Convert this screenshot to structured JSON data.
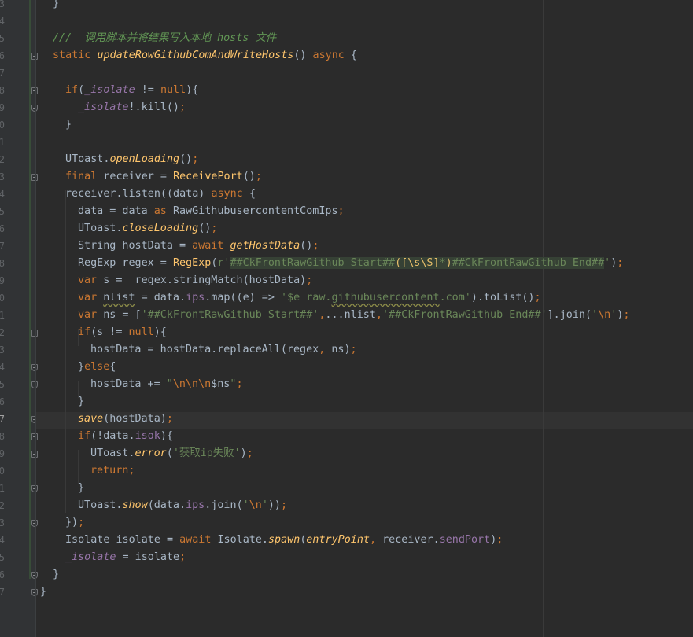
{
  "editor": {
    "colors": {
      "background": "#2b2b2b",
      "gutter": "#313335",
      "caret_line": "#323232",
      "keyword": "#cc7832",
      "function": "#ffc66d",
      "field": "#9876aa",
      "string": "#6a8759",
      "comment": "#629755",
      "text": "#a9b7c6",
      "line_number": "#606366"
    },
    "current_line_number": "7",
    "lines": [
      {
        "n": "3",
        "indent": 1,
        "tokens": [
          [
            "}",
            "p"
          ]
        ]
      },
      {
        "n": "4",
        "indent": 0,
        "tokens": []
      },
      {
        "n": "5",
        "indent": 1,
        "tokens": [
          [
            "///  调用脚本并将结果写入本地 hosts 文件",
            "com"
          ]
        ]
      },
      {
        "n": "6",
        "indent": 1,
        "tokens": [
          [
            "static ",
            "kw"
          ],
          [
            "updateRowGithubComAndWriteHosts",
            "fni"
          ],
          [
            "() ",
            "p"
          ],
          [
            "async ",
            "kw"
          ],
          [
            "{",
            "p"
          ]
        ]
      },
      {
        "n": "7",
        "indent": 0,
        "tokens": []
      },
      {
        "n": "8",
        "indent": 2,
        "tokens": [
          [
            "if",
            "kw"
          ],
          [
            "(",
            "p"
          ],
          [
            "_isolate",
            "fld"
          ],
          [
            " != ",
            "p"
          ],
          [
            "null",
            "kw"
          ],
          [
            "){",
            "p"
          ]
        ]
      },
      {
        "n": "9",
        "indent": 3,
        "tokens": [
          [
            "_isolate",
            "fld"
          ],
          [
            "!.kill()",
            "p"
          ],
          [
            ";",
            "kw"
          ]
        ]
      },
      {
        "n": "0",
        "indent": 2,
        "tokens": [
          [
            "}",
            "p"
          ]
        ]
      },
      {
        "n": "1",
        "indent": 0,
        "tokens": []
      },
      {
        "n": "2",
        "indent": 2,
        "tokens": [
          [
            "UToast.",
            "p"
          ],
          [
            "openLoading",
            "fni"
          ],
          [
            "()",
            "p"
          ],
          [
            ";",
            "kw"
          ]
        ]
      },
      {
        "n": "3",
        "indent": 2,
        "tokens": [
          [
            "final ",
            "kw"
          ],
          [
            "receiver = ",
            "p"
          ],
          [
            "ReceivePort",
            "fn"
          ],
          [
            "()",
            "p"
          ],
          [
            ";",
            "kw"
          ]
        ]
      },
      {
        "n": "4",
        "indent": 2,
        "tokens": [
          [
            "receiver.listen((data) ",
            "p"
          ],
          [
            "async ",
            "kw"
          ],
          [
            "{",
            "p"
          ]
        ]
      },
      {
        "n": "5",
        "indent": 3,
        "tokens": [
          [
            "data = data ",
            "p"
          ],
          [
            "as ",
            "kw"
          ],
          [
            "RawGithubusercontentComIps",
            "p"
          ],
          [
            ";",
            "kw"
          ]
        ]
      },
      {
        "n": "6",
        "indent": 3,
        "tokens": [
          [
            "UToast.",
            "p"
          ],
          [
            "closeLoading",
            "fni"
          ],
          [
            "()",
            "p"
          ],
          [
            ";",
            "kw"
          ]
        ]
      },
      {
        "n": "7",
        "indent": 3,
        "tokens": [
          [
            "String hostData = ",
            "p"
          ],
          [
            "await ",
            "kw"
          ],
          [
            "getHostData",
            "fni"
          ],
          [
            "()",
            "p"
          ],
          [
            ";",
            "kw"
          ]
        ]
      },
      {
        "n": "8",
        "indent": 3,
        "tokens": [
          [
            "RegExp regex = ",
            "p"
          ],
          [
            "RegExp",
            "fn"
          ],
          [
            "(",
            "p"
          ],
          [
            "r'",
            "str"
          ],
          [
            "##CkFrontRawGithub Start##",
            "regex"
          ],
          [
            "([\\s\\S]",
            "rxs"
          ],
          [
            "*",
            "regex"
          ],
          [
            ")",
            "rxs"
          ],
          [
            "##CkFrontRawGithub End##",
            "regex"
          ],
          [
            "'",
            "str"
          ],
          [
            ")",
            "p"
          ],
          [
            ";",
            "kw"
          ]
        ]
      },
      {
        "n": "9",
        "indent": 3,
        "tokens": [
          [
            "var ",
            "kw"
          ],
          [
            "s =  regex.stringMatch(hostData)",
            "p"
          ],
          [
            ";",
            "kw"
          ]
        ]
      },
      {
        "n": "0",
        "indent": 3,
        "tokens": [
          [
            "var ",
            "kw"
          ],
          [
            "nlist",
            "warn"
          ],
          [
            " = data.",
            "p"
          ],
          [
            "ips",
            "prop"
          ],
          [
            ".map((e) => ",
            "p"
          ],
          [
            "'$e ",
            "str"
          ],
          [
            "raw.",
            "str"
          ],
          [
            "githubusercontent",
            "strwarn"
          ],
          [
            ".com'",
            "str"
          ],
          [
            ").toList()",
            "p"
          ],
          [
            ";",
            "kw"
          ]
        ]
      },
      {
        "n": "1",
        "indent": 3,
        "tokens": [
          [
            "var ",
            "kw"
          ],
          [
            "ns = [",
            "p"
          ],
          [
            "'##CkFrontRawGithub Start##'",
            "str"
          ],
          [
            ",",
            "kw"
          ],
          [
            "...nlist",
            "p"
          ],
          [
            ",",
            "kw"
          ],
          [
            "'##CkFrontRawGithub End##'",
            "str"
          ],
          [
            "].join(",
            "p"
          ],
          [
            "'",
            "str"
          ],
          [
            "\\n",
            "esc"
          ],
          [
            "'",
            "str"
          ],
          [
            ")",
            "p"
          ],
          [
            ";",
            "kw"
          ]
        ]
      },
      {
        "n": "2",
        "indent": 3,
        "tokens": [
          [
            "if",
            "kw"
          ],
          [
            "(s != ",
            "p"
          ],
          [
            "null",
            "kw"
          ],
          [
            "){",
            "p"
          ]
        ]
      },
      {
        "n": "3",
        "indent": 4,
        "tokens": [
          [
            "hostData = hostData.replaceAll(regex",
            "p"
          ],
          [
            ", ",
            "kw"
          ],
          [
            "ns)",
            "p"
          ],
          [
            ";",
            "kw"
          ]
        ]
      },
      {
        "n": "4",
        "indent": 3,
        "tokens": [
          [
            "}",
            "p"
          ],
          [
            "else",
            "kw"
          ],
          [
            "{",
            "p"
          ]
        ]
      },
      {
        "n": "5",
        "indent": 4,
        "tokens": [
          [
            "hostData += ",
            "p"
          ],
          [
            "\"",
            "str"
          ],
          [
            "\\n\\n\\n",
            "esc"
          ],
          [
            "$ns",
            "p"
          ],
          [
            "\"",
            "str"
          ],
          [
            ";",
            "kw"
          ]
        ]
      },
      {
        "n": "6",
        "indent": 3,
        "tokens": [
          [
            "}",
            "p"
          ]
        ]
      },
      {
        "n": "7",
        "indent": 3,
        "tokens": [
          [
            "save",
            "fni"
          ],
          [
            "(hostData)",
            "p"
          ],
          [
            ";",
            "kw"
          ]
        ]
      },
      {
        "n": "8",
        "indent": 3,
        "tokens": [
          [
            "if",
            "kw"
          ],
          [
            "(!data.",
            "p"
          ],
          [
            "isok",
            "prop"
          ],
          [
            "){",
            "p"
          ]
        ]
      },
      {
        "n": "9",
        "indent": 4,
        "tokens": [
          [
            "UToast.",
            "p"
          ],
          [
            "error",
            "fni"
          ],
          [
            "(",
            "p"
          ],
          [
            "'获取ip失败'",
            "str"
          ],
          [
            ")",
            "p"
          ],
          [
            ";",
            "kw"
          ]
        ]
      },
      {
        "n": "0",
        "indent": 4,
        "tokens": [
          [
            "return",
            "kw"
          ],
          [
            ";",
            "kw"
          ]
        ]
      },
      {
        "n": "1",
        "indent": 3,
        "tokens": [
          [
            "}",
            "p"
          ]
        ]
      },
      {
        "n": "2",
        "indent": 3,
        "tokens": [
          [
            "UToast.",
            "p"
          ],
          [
            "show",
            "fni"
          ],
          [
            "(data.",
            "p"
          ],
          [
            "ips",
            "prop"
          ],
          [
            ".join(",
            "p"
          ],
          [
            "'",
            "str"
          ],
          [
            "\\n",
            "esc"
          ],
          [
            "'",
            "str"
          ],
          [
            "))",
            "p"
          ],
          [
            ";",
            "kw"
          ]
        ]
      },
      {
        "n": "3",
        "indent": 2,
        "tokens": [
          [
            "})",
            "p"
          ],
          [
            ";",
            "kw"
          ]
        ]
      },
      {
        "n": "4",
        "indent": 2,
        "tokens": [
          [
            "Isolate isolate = ",
            "p"
          ],
          [
            "await ",
            "kw"
          ],
          [
            "Isolate.",
            "p"
          ],
          [
            "spawn",
            "fni"
          ],
          [
            "(",
            "p"
          ],
          [
            "entryPoint",
            "fni"
          ],
          [
            ", ",
            "kw"
          ],
          [
            "receiver.",
            "p"
          ],
          [
            "sendPort",
            "prop"
          ],
          [
            ")",
            "p"
          ],
          [
            ";",
            "kw"
          ]
        ]
      },
      {
        "n": "5",
        "indent": 2,
        "tokens": [
          [
            "_isolate",
            "fld"
          ],
          [
            " = isolate",
            "p"
          ],
          [
            ";",
            "kw"
          ]
        ]
      },
      {
        "n": "6",
        "indent": 1,
        "tokens": [
          [
            "}",
            "p"
          ]
        ]
      },
      {
        "n": "7",
        "indent": 0,
        "tokens": [
          [
            "}",
            "p"
          ]
        ]
      }
    ]
  }
}
